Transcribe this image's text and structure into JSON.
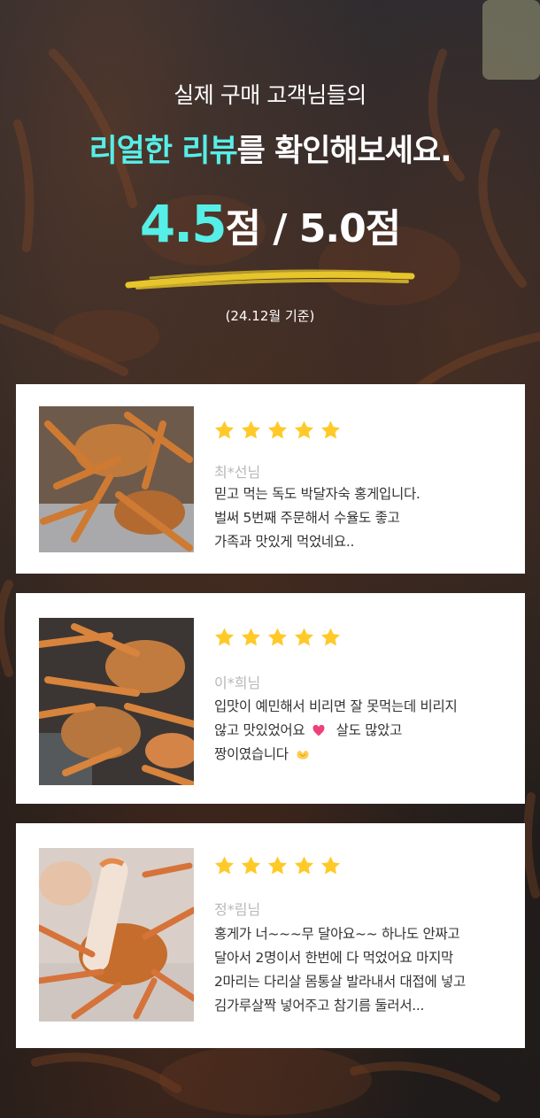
{
  "header": {
    "subtitle": "실제 구매 고객님들의",
    "headline_accent": "리얼한 리뷰",
    "headline_rest": "를 확인해보세요.",
    "score_value": "4.5",
    "score_unit": "점",
    "score_rest": " / 5.0점",
    "basis": "(24.12월 기준)"
  },
  "colors": {
    "accent": "#56efe8",
    "star": "#ffc928",
    "underline": "#e7c62c"
  },
  "reviews": [
    {
      "rating": 5,
      "author": "최*선님",
      "lines": [
        "믿고 먹는 독도 박달자숙 홍게입니다.",
        "벌써 5번째 주문해서 수율도 좋고",
        "가족과 맛있게 먹었네요.."
      ]
    },
    {
      "rating": 5,
      "author": "이*희님",
      "lines": [
        "입맛이 예민해서 비리면 잘 못먹는데 비리지",
        "않고 맛있었어요",
        "살도 많았고",
        "짱이였습니다"
      ],
      "icons": [
        "heart-icon",
        "hands-icon"
      ]
    },
    {
      "rating": 5,
      "author": "정*림님",
      "lines": [
        "홍게가 너~~~무 달아요~~ 하나도 안짜고",
        "달아서 2명이서 한번에 다 먹었어요 마지막",
        "2마리는 다리살 몸통살 발라내서 대접에 넣고",
        "김가루살짝 넣어주고 참기름 둘러서..."
      ]
    }
  ]
}
